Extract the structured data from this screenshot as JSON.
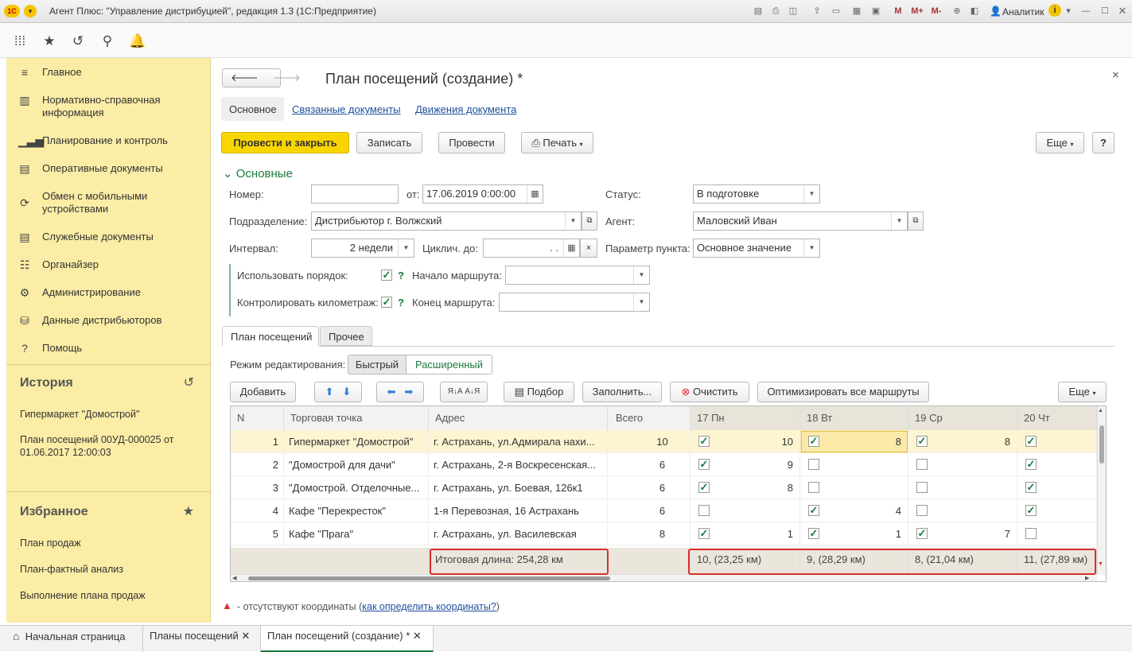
{
  "window": {
    "title": "Агент Плюс: \"Управление дистрибуцией\", редакция 1.3  (1С:Предприятие)",
    "user": "Аналитик"
  },
  "sidebar": {
    "items": [
      {
        "label": "Главное",
        "icon": "menu-icon"
      },
      {
        "label": "Нормативно-справочная информация",
        "icon": "catalog-icon"
      },
      {
        "label": "Планирование и контроль",
        "icon": "chart-icon"
      },
      {
        "label": "Оперативные документы",
        "icon": "documents-icon"
      },
      {
        "label": "Обмен с мобильными устройствами",
        "icon": "sync-icon"
      },
      {
        "label": "Служебные документы",
        "icon": "service-docs-icon"
      },
      {
        "label": "Органайзер",
        "icon": "organizer-icon"
      },
      {
        "label": "Администрирование",
        "icon": "gear-icon"
      },
      {
        "label": "Данные дистрибьюторов",
        "icon": "distributor-icon"
      },
      {
        "label": "Помощь",
        "icon": "help-icon"
      }
    ],
    "history_title": "История",
    "history": [
      "Гипермаркет \"Домострой\"",
      "План посещений 00УД-000025 от 01.06.2017 12:00:03"
    ],
    "favorites_title": "Избранное",
    "favorites": [
      "План продаж",
      "План-фактный анализ",
      "Выполнение плана продаж"
    ]
  },
  "form": {
    "title": "План посещений  (создание) *",
    "tabs": [
      "Основное",
      "Связанные документы",
      "Движения документа"
    ],
    "buttons": {
      "post_close": "Провести и закрыть",
      "save": "Записать",
      "post": "Провести",
      "print": "Печать",
      "more": "Еще",
      "help": "?"
    },
    "section": "Основные",
    "fields": {
      "number_label": "Номер:",
      "number_value": "",
      "from_label": "от:",
      "date_value": "17.06.2019  0:00:00",
      "status_label": "Статус:",
      "status_value": "В подготовке",
      "division_label": "Подразделение:",
      "division_value": "Дистрибьютор г. Волжский",
      "agent_label": "Агент:",
      "agent_value": "Маловский Иван",
      "interval_label": "Интервал:",
      "interval_value": "2 недели",
      "cycle_label": "Циклич. до:",
      "cycle_value": ".   .",
      "point_param_label": "Параметр пункта:",
      "point_param_value": "Основное значение",
      "use_order_label": "Использовать порядок:",
      "route_start_label": "Начало маршрута:",
      "control_km_label": "Контролировать километраж:",
      "route_end_label": "Конец маршрута:",
      "q": "?"
    },
    "inner_tabs": [
      "План посещений",
      "Прочее"
    ],
    "edit_mode_label": "Режим редактирования:",
    "edit_modes": [
      "Быстрый",
      "Расширенный"
    ],
    "grid_buttons": {
      "add": "Добавить",
      "pick": "Подбор",
      "fill": "Заполнить...",
      "clear": "Очистить",
      "optimize": "Оптимизировать все маршруты",
      "more": "Еще"
    },
    "columns": [
      "N",
      "Торговая точка",
      "Адрес",
      "Всего",
      "17 Пн",
      "18 Вт",
      "19 Ср",
      "20 Чт"
    ],
    "rows": [
      {
        "n": "1",
        "point": "Гипермаркет \"Домострой\"",
        "address": "г. Астрахань, ул.Адмирала нахи...",
        "total": "10",
        "d1": true,
        "d1v": "10",
        "d2": true,
        "d2v": "8",
        "d3": true,
        "d3v": "8",
        "d4": true
      },
      {
        "n": "2",
        "point": "\"Домострой для дачи\"",
        "address": "г. Астрахань, 2-я Воскресенская...",
        "total": "6",
        "d1": true,
        "d1v": "9",
        "d2": false,
        "d2v": "",
        "d3": false,
        "d3v": "",
        "d4": true
      },
      {
        "n": "3",
        "point": "\"Домострой. Отделочные...",
        "address": "г. Астрахань, ул. Боевая, 126к1",
        "total": "6",
        "d1": true,
        "d1v": "8",
        "d2": false,
        "d2v": "",
        "d3": false,
        "d3v": "",
        "d4": true
      },
      {
        "n": "4",
        "point": "Кафе \"Перекресток\"",
        "address": "1-я Перевозная, 16 Астрахань",
        "total": "6",
        "d1": false,
        "d1v": "",
        "d2": true,
        "d2v": "4",
        "d3": false,
        "d3v": "",
        "d4": true
      },
      {
        "n": "5",
        "point": "Кафе \"Прага\"",
        "address": "г. Астрахань, ул. Василевская",
        "total": "8",
        "d1": true,
        "d1v": "1",
        "d2": true,
        "d2v": "1",
        "d3": true,
        "d3v": "7",
        "d4": false
      }
    ],
    "footer": {
      "total_length": "Итоговая длина: 254,28 км",
      "d1": "10, (23,25 км)",
      "d2": "9, (28,29 км)",
      "d3": "8, (21,04 км)",
      "d4": "11, (27,89 км)"
    },
    "note_text": " - отсутствуют координаты (",
    "note_link": "как определить координаты?",
    "note_end": ")"
  },
  "bottom_tabs": [
    "Начальная страница",
    "Планы посещений",
    "План посещений  (создание) *"
  ],
  "colors": {
    "sidebar": "#fbeda6",
    "primary_button": "#f9d500",
    "selected_row": "#fdf5d2",
    "accent_green": "#1a7b3c",
    "highlight_red": "#d9302c"
  }
}
